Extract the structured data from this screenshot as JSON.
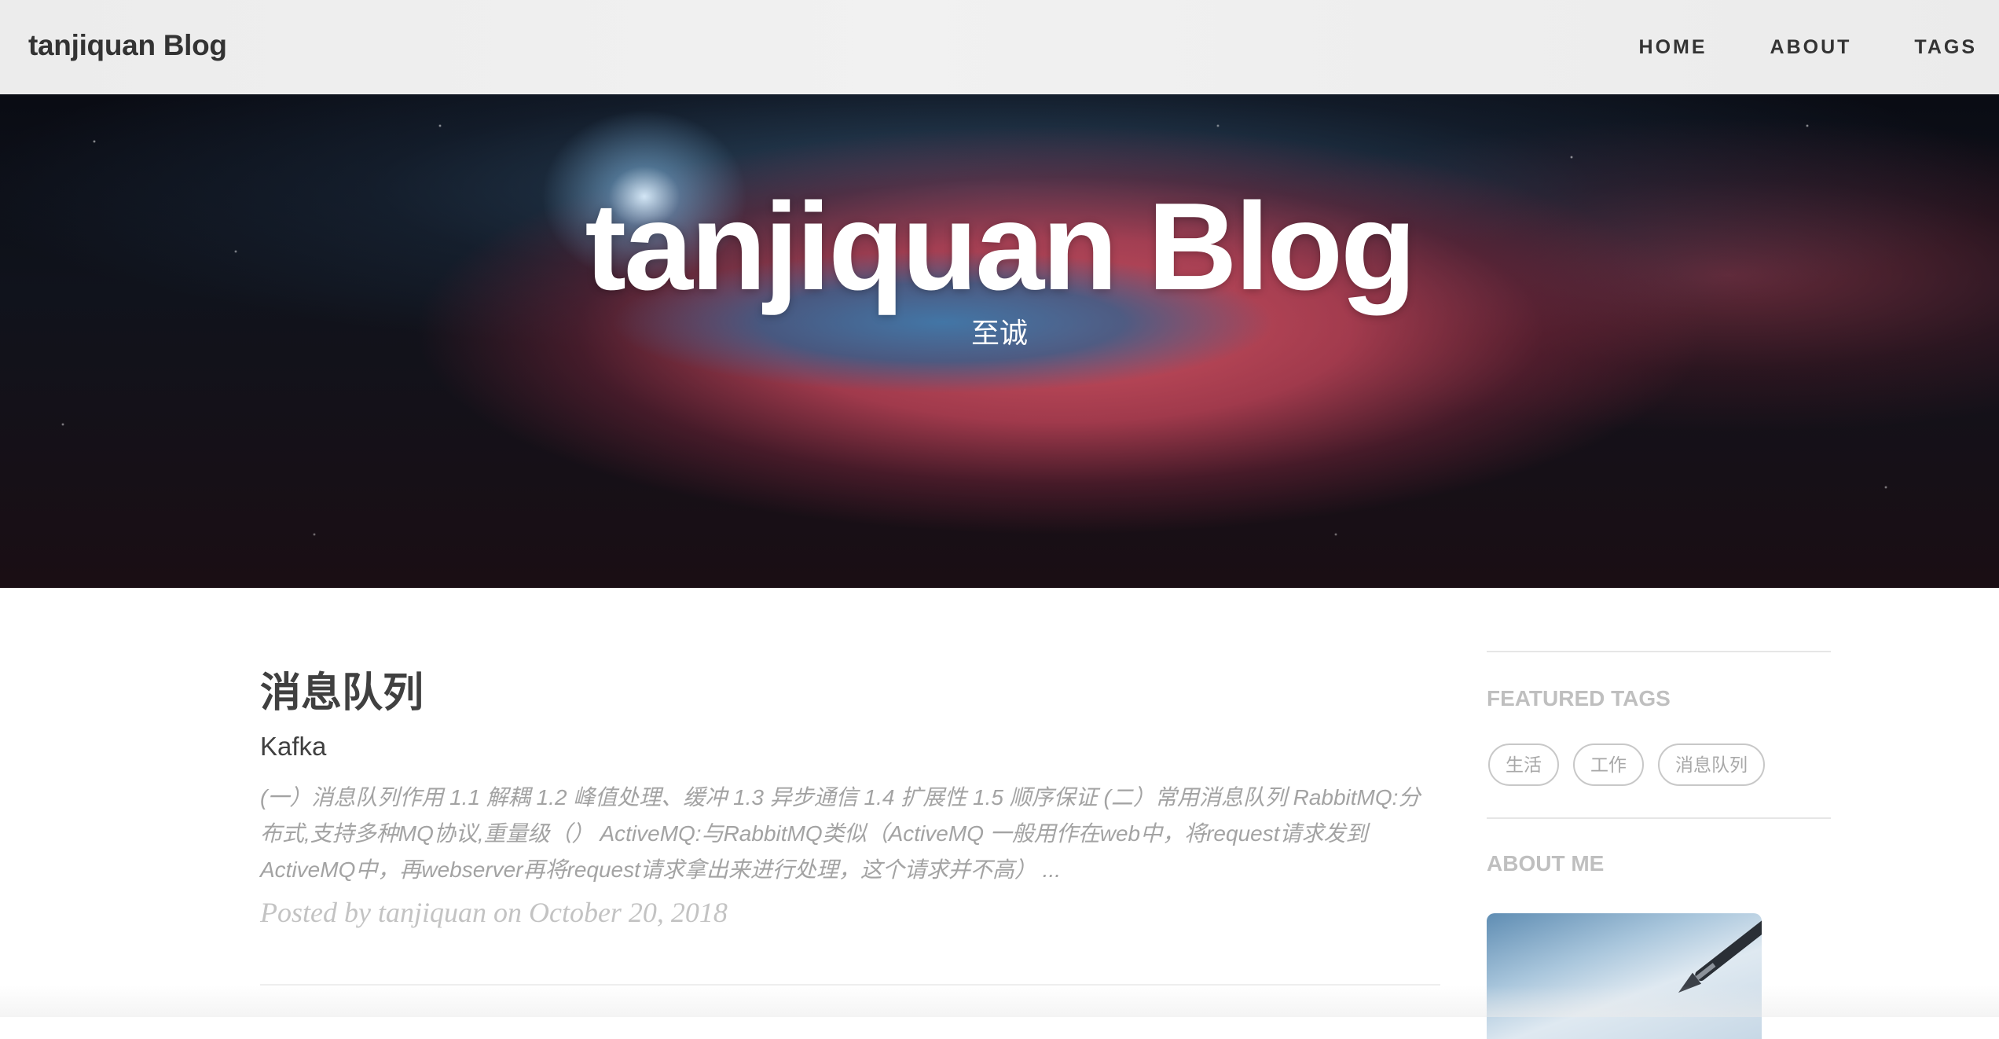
{
  "navbar": {
    "brand": "tanjiquan Blog",
    "links": [
      "HOME",
      "ABOUT",
      "TAGS"
    ]
  },
  "hero": {
    "title": "tanjiquan Blog",
    "subtitle": "至诚"
  },
  "post": {
    "title": "消息队列",
    "subtitle": "Kafka",
    "excerpt": "(一）消息队列作用 1.1 解耦 1.2 峰值处理、缓冲 1.3 异步通信 1.4 扩展性 1.5 顺序保证 (二）常用消息队列 RabbitMQ:分布式,支持多种MQ协议,重量级（） ActiveMQ:与RabbitMQ类似（ActiveMQ 一般用作在web中，将request请求发到ActiveMQ中，再webserver再将request请求拿出来进行处理，这个请求并不高） ...",
    "meta": "Posted by tanjiquan on October 20, 2018"
  },
  "sidebar": {
    "featured_tags_heading": "FEATURED TAGS",
    "tags": [
      "生活",
      "工作",
      "消息队列"
    ],
    "about_heading": "ABOUT ME"
  },
  "colors": {
    "navbar_bg": "#eeeeee",
    "text_dark": "#404040",
    "text_muted": "#a3a3a3",
    "meta_text": "#c3c3c3",
    "sidebar_heading": "#bfbfbf"
  },
  "icons": {
    "avatar": "fountain-pen-image"
  }
}
